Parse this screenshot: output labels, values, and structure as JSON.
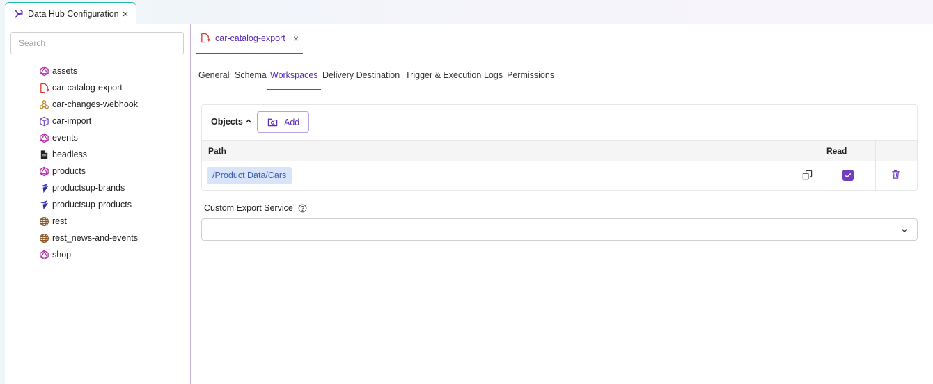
{
  "app_tab": {
    "title": "Data Hub Configuration",
    "close": "×"
  },
  "sidebar": {
    "search_placeholder": "Search",
    "items": [
      {
        "label": "assets",
        "icon": "graphql-icon"
      },
      {
        "label": "car-catalog-export",
        "icon": "file-export-icon"
      },
      {
        "label": "car-changes-webhook",
        "icon": "webhook-icon"
      },
      {
        "label": "car-import",
        "icon": "cube-import-icon"
      },
      {
        "label": "events",
        "icon": "graphql-icon"
      },
      {
        "label": "headless",
        "icon": "document-icon"
      },
      {
        "label": "products",
        "icon": "graphql-icon"
      },
      {
        "label": "productsup-brands",
        "icon": "productsup-icon"
      },
      {
        "label": "productsup-products",
        "icon": "productsup-icon"
      },
      {
        "label": "rest",
        "icon": "globe-icon"
      },
      {
        "label": "rest_news-and-events",
        "icon": "globe-icon"
      },
      {
        "label": "shop",
        "icon": "graphql-icon"
      }
    ]
  },
  "file_tab": {
    "label": "car-catalog-export",
    "close": "×"
  },
  "sub_tabs": [
    "General",
    "Schema",
    "Workspaces",
    "Delivery Destination",
    "Trigger & Execution",
    "Logs",
    "Permissions"
  ],
  "active_sub_tab": "Workspaces",
  "objects": {
    "title": "Objects",
    "add_label": "Add",
    "columns": {
      "path": "Path",
      "read": "Read"
    },
    "rows": [
      {
        "path": "/Product Data/Cars",
        "read": true
      }
    ]
  },
  "custom_export": {
    "label": "Custom Export Service",
    "value": ""
  },
  "colors": {
    "accent": "#6f3fbf",
    "teal": "#1fb6a8",
    "tag_bg": "#d8e4fa",
    "tag_text": "#3c5bb0"
  }
}
